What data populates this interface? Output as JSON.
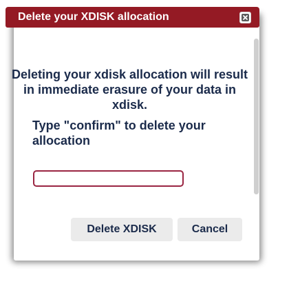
{
  "dialog": {
    "title": "Delete your XDISK allocation",
    "close_icon": "close-icon",
    "message": "Deleting your xdisk allocation will result in immediate erasure of your data in xdisk.",
    "prompt": "Type \"confirm\" to delete your allocation",
    "input": {
      "value": "",
      "placeholder": ""
    },
    "buttons": {
      "delete_label": "Delete XDISK",
      "cancel_label": "Cancel"
    }
  },
  "colors": {
    "titlebar": "#941a24",
    "text": "#1b2b4b",
    "input_border": "#9a2542",
    "button_bg": "#ebebeb"
  }
}
